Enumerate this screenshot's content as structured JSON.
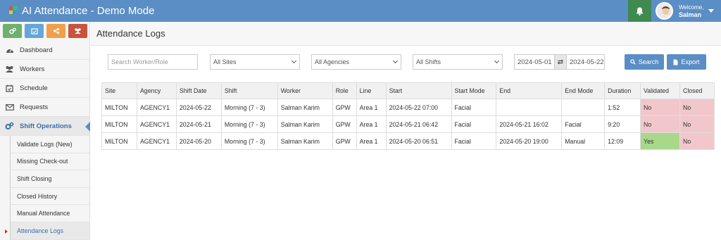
{
  "app": {
    "title": "AI Attendance - Demo Mode"
  },
  "user": {
    "welcome": "Welcome,",
    "name": "Salman"
  },
  "quick_buttons": [
    {
      "icon": "cogs-icon",
      "color": "#6fb06f"
    },
    {
      "icon": "calendar-check-icon",
      "color": "#64a7d8"
    },
    {
      "icon": "share-nodes-icon",
      "color": "#f0a04b"
    },
    {
      "icon": "users-icon",
      "color": "#c9533c"
    }
  ],
  "sidebar": {
    "items": [
      {
        "label": "Dashboard",
        "icon": "dashboard-icon"
      },
      {
        "label": "Workers",
        "icon": "users-icon"
      },
      {
        "label": "Schedule",
        "icon": "calendar-icon"
      },
      {
        "label": "Requests",
        "icon": "envelope-icon"
      },
      {
        "label": "Shift Operations",
        "icon": "cogs-icon"
      }
    ],
    "sub_items": [
      {
        "label": "Validate Logs (New)"
      },
      {
        "label": "Missing Check-out"
      },
      {
        "label": "Shift Closing"
      },
      {
        "label": "Closed History"
      },
      {
        "label": "Manual Attendance"
      },
      {
        "label": "Attendance Logs"
      }
    ]
  },
  "page": {
    "title": "Attendance Logs"
  },
  "filters": {
    "search_placeholder": "Search Worker/Role",
    "sites": "All Sites",
    "agencies": "All Agencies",
    "shifts": "All Shifts",
    "date_from": "2024-05-01",
    "date_to": "2024-05-22",
    "search_label": "Search",
    "export_label": "Export"
  },
  "table": {
    "headers": [
      "Site",
      "Agency",
      "Shift Date",
      "Shift",
      "Worker",
      "Role",
      "Line",
      "Start",
      "Start Mode",
      "End",
      "End Mode",
      "Duration",
      "Validated",
      "Closed"
    ],
    "rows": [
      [
        "MILTON",
        "AGENCY1",
        "2024-05-22",
        "Morning (7 - 3)",
        "Salman Karim",
        "GPW",
        "Area 1",
        "2024-05-22 07:00",
        "Facial",
        "",
        "",
        "1:52",
        "No",
        "No"
      ],
      [
        "MILTON",
        "AGENCY1",
        "2024-05-21",
        "Morning (7 - 3)",
        "Salman Karim",
        "GPW",
        "Area 1",
        "2024-05-21 06:42",
        "Facial",
        "2024-05-21 16:02",
        "Facial",
        "9:20",
        "No",
        "No"
      ],
      [
        "MILTON",
        "AGENCY1",
        "2024-05-20",
        "Morning (7 - 3)",
        "Salman Karim",
        "GPW",
        "Area 1",
        "2024-05-20 06:51",
        "Facial",
        "2024-05-20 19:00",
        "Manual",
        "12:09",
        "Yes",
        "No"
      ]
    ]
  },
  "colors": {
    "topbar": "#5b8ec4",
    "bell_bg": "#3f8a4f",
    "no_cell": "#f2c7cc",
    "yes_cell": "#a8d88a"
  }
}
